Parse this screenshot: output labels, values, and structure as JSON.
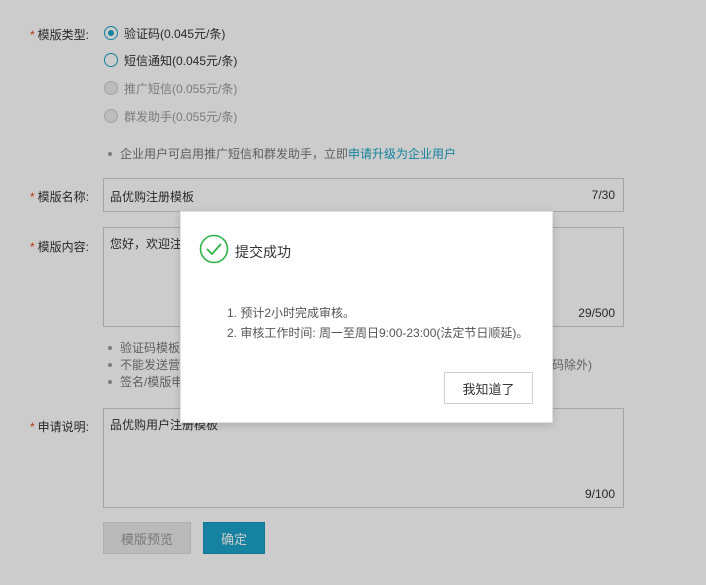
{
  "form": {
    "template_type": {
      "label": "模版类型:",
      "options": [
        {
          "label": "验证码(0.045元/条)",
          "checked": true,
          "disabled": false
        },
        {
          "label": "短信通知(0.045元/条)",
          "checked": false,
          "disabled": false
        },
        {
          "label": "推广短信(0.055元/条)",
          "checked": false,
          "disabled": true
        },
        {
          "label": "群发助手(0.055元/条)",
          "checked": false,
          "disabled": true
        }
      ],
      "hint_prefix": "企业用户可启用推广短信和群发助手，立即",
      "hint_link": "申请升级为企业用户"
    },
    "template_name": {
      "label": "模版名称:",
      "value": "品优购注册模板",
      "count": "7/30"
    },
    "template_content": {
      "label": "模版内容:",
      "value": "您好，欢迎注",
      "count": "29/500",
      "notes": [
        "验证码模板",
        "不能发送营",
        "签名/模版申"
      ],
      "notes_tail": "码除外)"
    },
    "apply_note": {
      "label": "申请说明:",
      "value": "品优购用户注册模板",
      "count": "9/100"
    },
    "buttons": {
      "preview": "模版预览",
      "confirm": "确定"
    }
  },
  "modal": {
    "title": "提交成功",
    "lines": [
      "1. 预计2小时完成审核。",
      "2. 审核工作时间: 周一至周日9:00-23:00(法定节日顺延)。"
    ],
    "ok_button": "我知道了"
  },
  "colors": {
    "accent": "#1aa3c8",
    "required": "#e64a19",
    "success": "#2eb34a"
  }
}
